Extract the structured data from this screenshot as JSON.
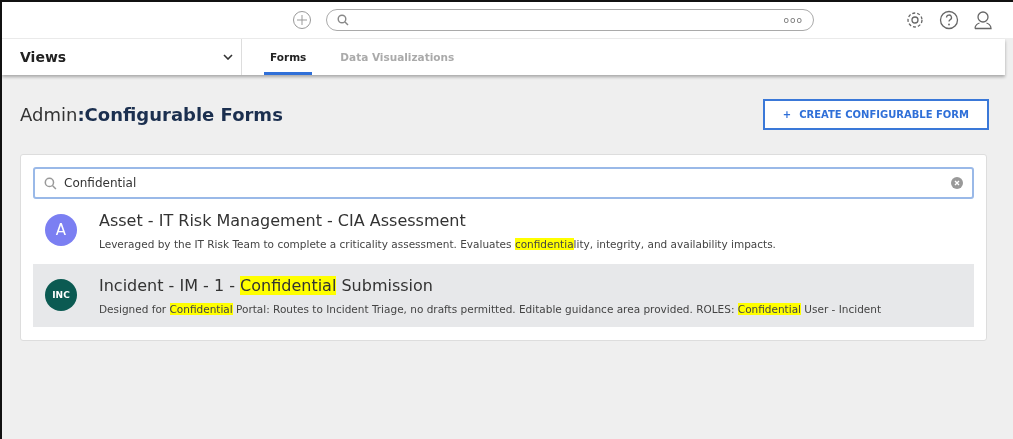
{
  "header": {
    "search": {
      "menu_glyph": "ooo"
    }
  },
  "views": {
    "label": "Views"
  },
  "tabs": [
    {
      "label": "Forms",
      "selected": true
    },
    {
      "label": "Data Visualizations",
      "selected": false
    }
  ],
  "page": {
    "title_prefix": "Admin",
    "title_separator": ":",
    "title": "Configurable Forms",
    "create_button": {
      "icon": "+",
      "label": "CREATE CONFIGURABLE FORM"
    }
  },
  "search": {
    "value": "Confidential"
  },
  "results": [
    {
      "avatar": "A",
      "color": "#7b7ff2",
      "selected": false,
      "title": [
        {
          "text": "Asset - IT Risk Management - CIA Assessment",
          "highlighted": false
        }
      ],
      "description": [
        {
          "text": "Leveraged by the IT Risk Team to complete a criticality assessment. Evaluates ",
          "highlighted": false
        },
        {
          "text": "confidentia",
          "highlighted": true
        },
        {
          "text": "lity, integrity, and availability impacts.",
          "highlighted": false
        }
      ]
    },
    {
      "avatar": "INC",
      "color": "#0b5a52",
      "selected": true,
      "title": [
        {
          "text": "Incident - IM - 1 - ",
          "highlighted": false
        },
        {
          "text": "Confidential",
          "highlighted": true
        },
        {
          "text": " Submission",
          "highlighted": false
        }
      ],
      "description": [
        {
          "text": "Designed for ",
          "highlighted": false
        },
        {
          "text": "Confidential",
          "highlighted": true
        },
        {
          "text": " Portal: Routes to Incident Triage, no drafts permitted. Editable guidance area provided. ROLES: ",
          "highlighted": false
        },
        {
          "text": "Confidential",
          "highlighted": true
        },
        {
          "text": " User - Incident",
          "highlighted": false
        }
      ]
    }
  ]
}
